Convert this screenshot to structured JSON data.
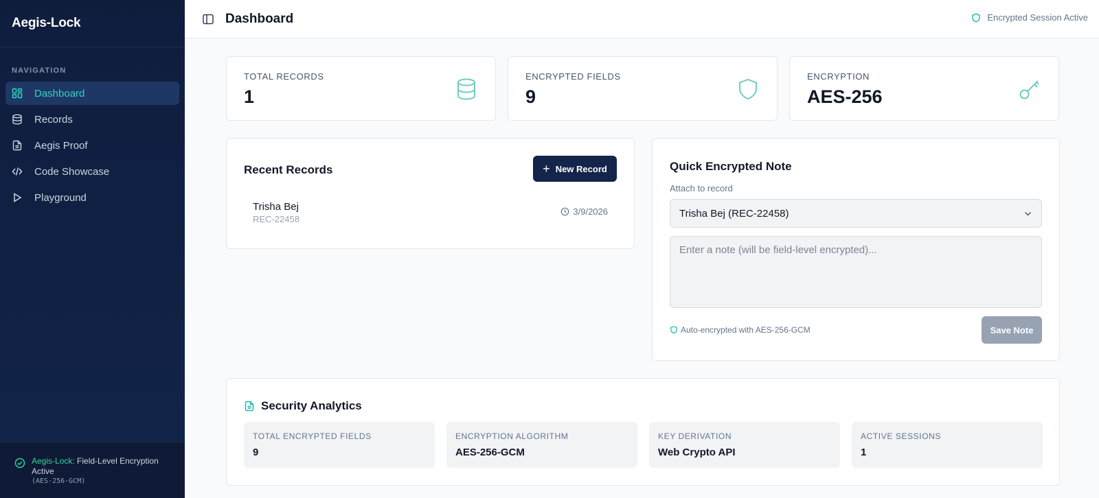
{
  "app": {
    "name": "Aegis-Lock"
  },
  "sidebar": {
    "heading": "NAVIGATION",
    "items": [
      {
        "label": "Dashboard",
        "icon": "grid-icon",
        "active": true
      },
      {
        "label": "Records",
        "icon": "database-icon"
      },
      {
        "label": "Aegis Proof",
        "icon": "file-icon"
      },
      {
        "label": "Code Showcase",
        "icon": "code-icon"
      },
      {
        "label": "Playground",
        "icon": "play-icon"
      }
    ],
    "footer": {
      "brand": "Aegis-Lock:",
      "text": "Field-Level Encryption Active",
      "algo": "(AES-256-GCM)"
    }
  },
  "header": {
    "title": "Dashboard",
    "session_status": "Encrypted Session Active"
  },
  "stats": [
    {
      "label": "TOTAL RECORDS",
      "value": "1",
      "icon": "database-icon"
    },
    {
      "label": "ENCRYPTED FIELDS",
      "value": "9",
      "icon": "shield-icon"
    },
    {
      "label": "ENCRYPTION",
      "value": "AES-256",
      "icon": "key-icon"
    }
  ],
  "recent": {
    "title": "Recent Records",
    "new_button": "New Record",
    "records": [
      {
        "name": "Trisha Bej",
        "id": "REC-22458",
        "date": "3/9/2026"
      }
    ]
  },
  "note": {
    "title": "Quick Encrypted Note",
    "attach_label": "Attach to record",
    "selected_record": "Trisha Bej (REC-22458)",
    "placeholder": "Enter a note (will be field-level encrypted)...",
    "value": "",
    "auto_encrypted": "Auto-encrypted with AES-256-GCM",
    "save_button": "Save Note"
  },
  "analytics": {
    "title": "Security Analytics",
    "metrics": [
      {
        "label": "TOTAL ENCRYPTED FIELDS",
        "value": "9"
      },
      {
        "label": "ENCRYPTION ALGORITHM",
        "value": "AES-256-GCM"
      },
      {
        "label": "KEY DERIVATION",
        "value": "Web Crypto API"
      },
      {
        "label": "ACTIVE SESSIONS",
        "value": "1"
      }
    ]
  },
  "colors": {
    "sidebar_bg": "#0f1d3d",
    "accent": "#2dd4bf",
    "primary_button": "#14254c",
    "disabled_button": "#97a2b3",
    "success": "#34d399"
  }
}
